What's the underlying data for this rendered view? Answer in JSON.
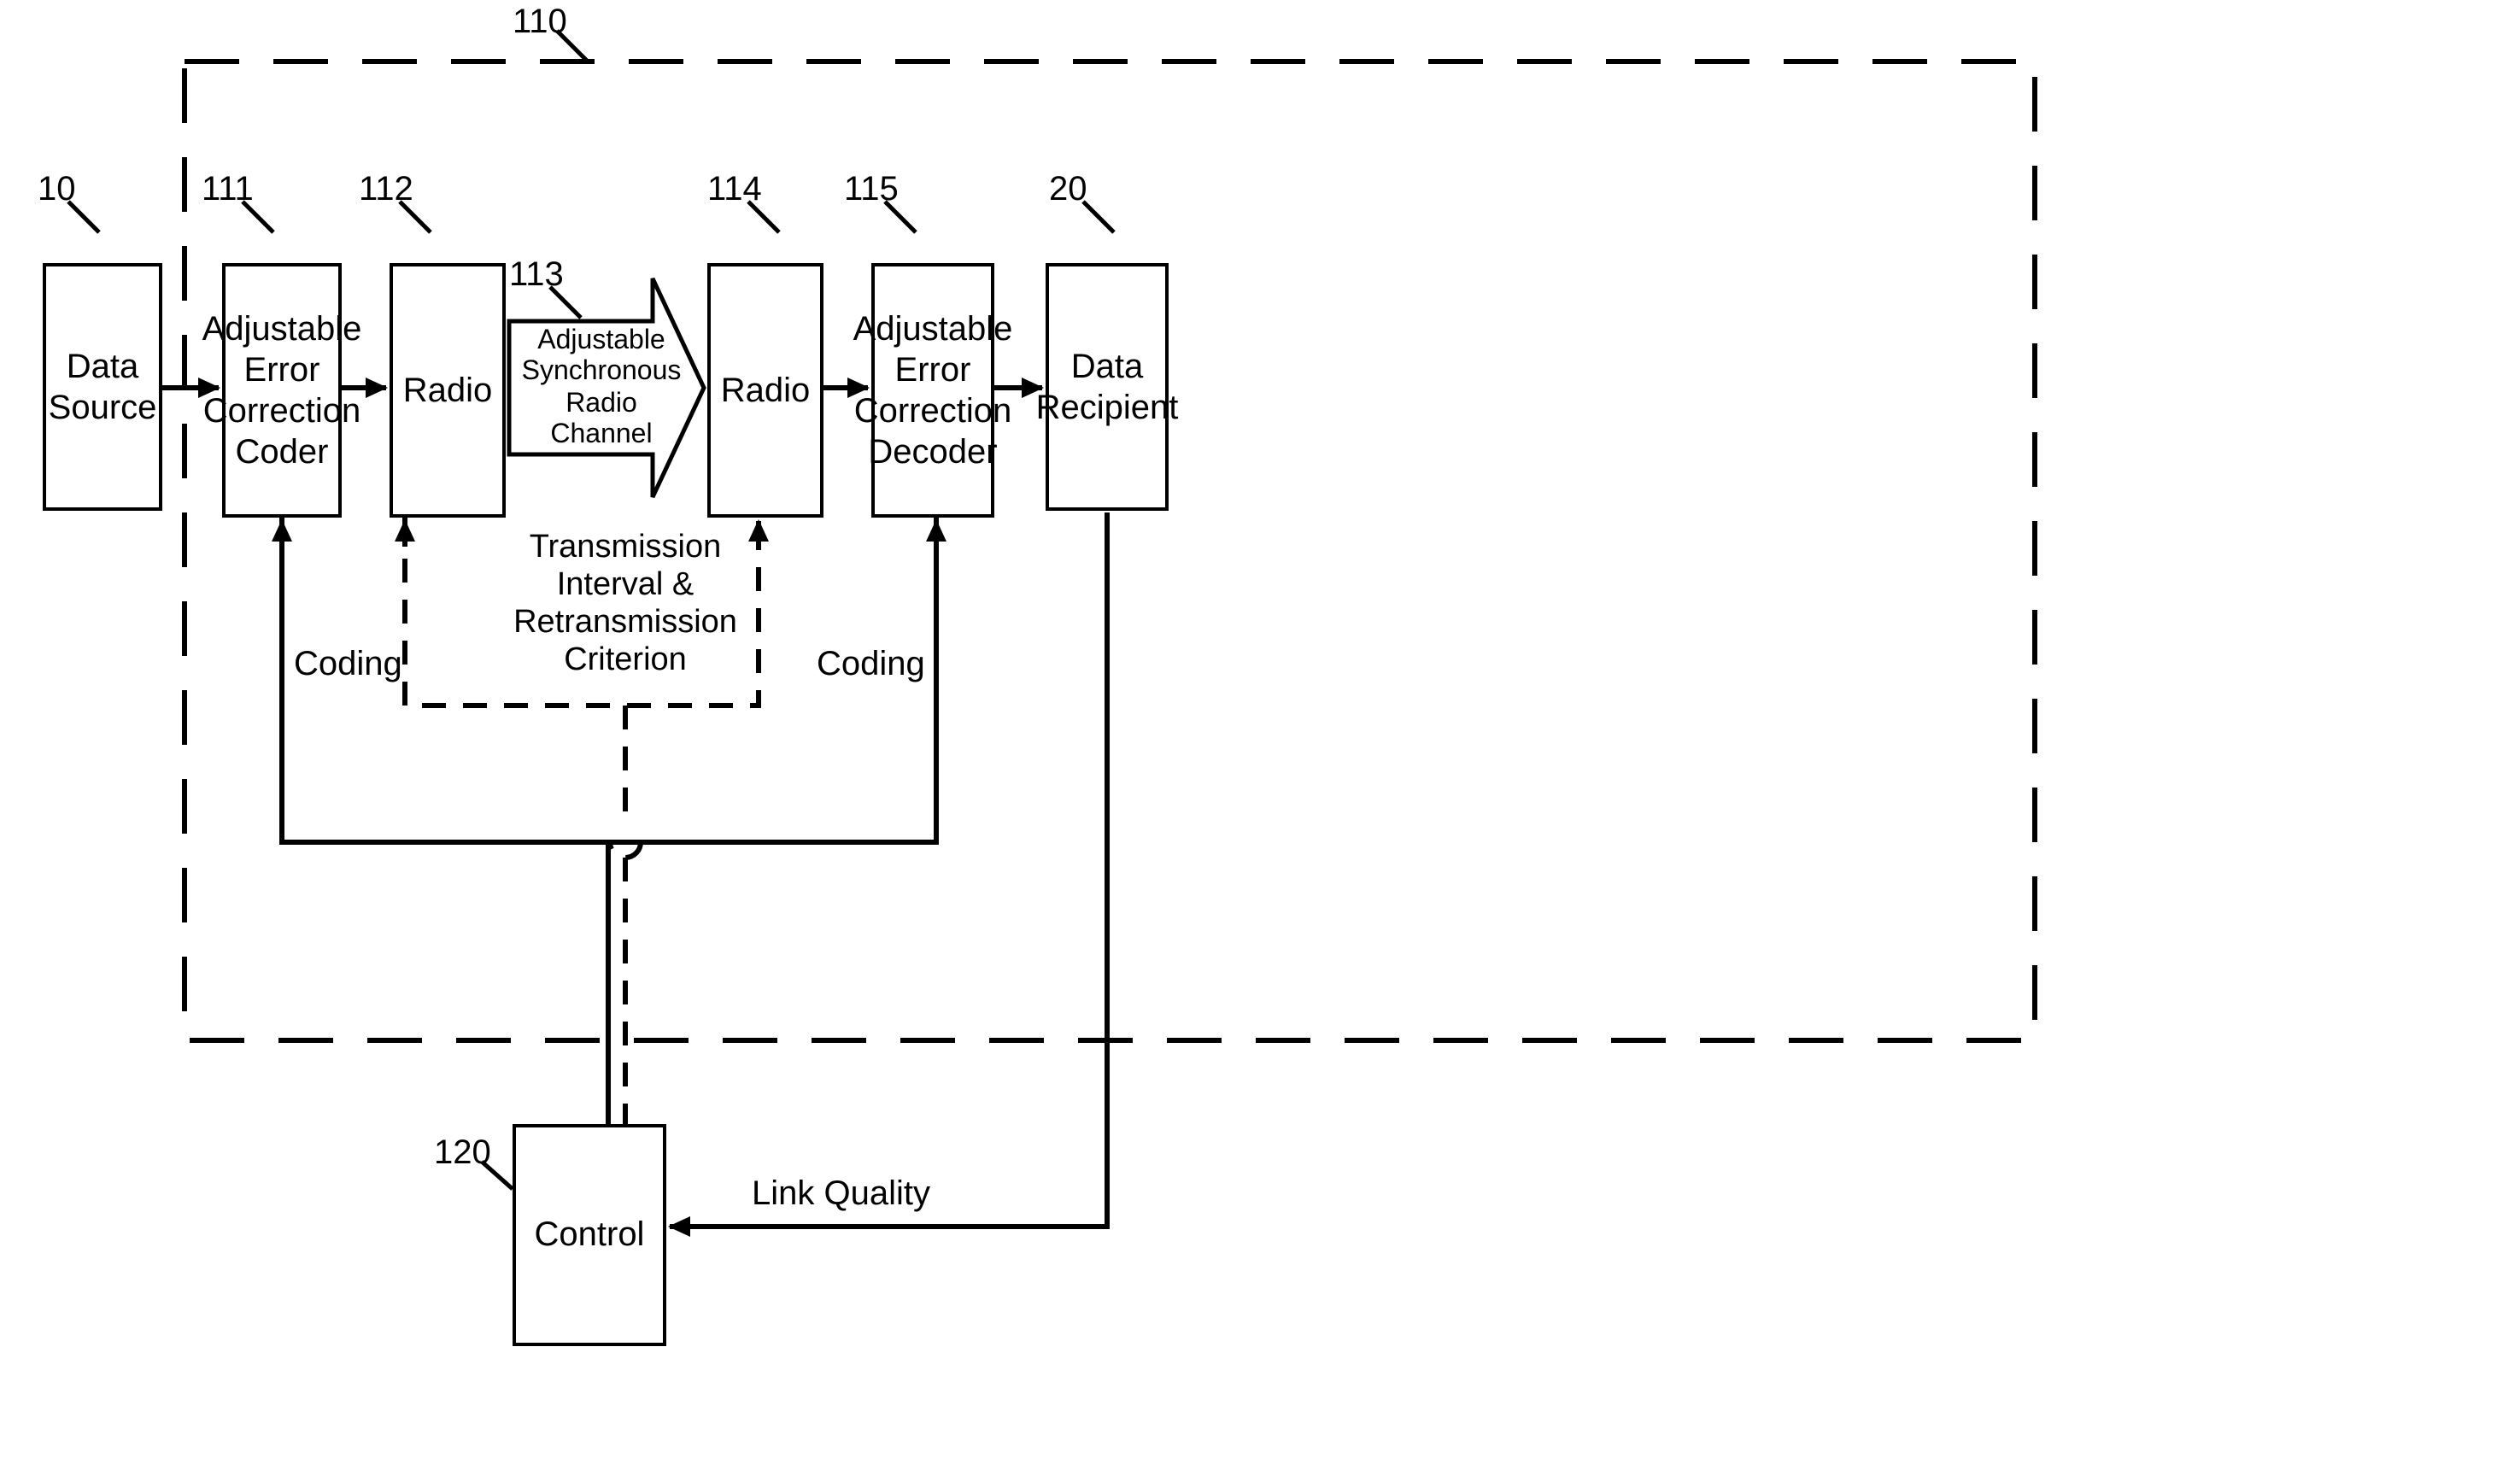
{
  "refs": {
    "dataSource": "10",
    "dashedBox": "110",
    "coder": "111",
    "radioTx": "112",
    "channel": "113",
    "radioRx": "114",
    "decoder": "115",
    "control": "120",
    "dataRecipient": "20"
  },
  "boxes": {
    "dataSource": "Data Source",
    "coder": "Adjustable Error Correction Coder",
    "radioTx": "Radio",
    "radioRx": "Radio",
    "decoder": "Adjustable Error Correction Decoder",
    "dataRecipient": "Data Recipient",
    "control": "Control"
  },
  "labels": {
    "channel": "Adjustable Synchronous Radio Channel",
    "transmission": "Transmission Interval & Retransmission Criterion",
    "codingLeft": "Coding",
    "codingRight": "Coding",
    "linkQuality": "Link Quality"
  }
}
